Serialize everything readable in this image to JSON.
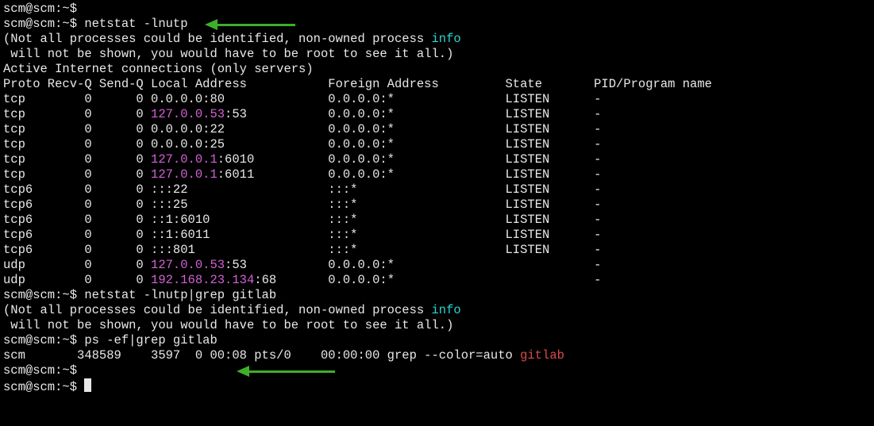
{
  "prompt_text": "scm@scm:~$",
  "cmd_netstat": " netstat -lnutp",
  "msg_line1a": "(Not all processes could be identified, non-owned process ",
  "msg_info": "info",
  "msg_line2": " will not be shown, you would have to be root to see it all.)",
  "active_conn": "Active Internet connections (only servers)",
  "hdr_proto": "Proto",
  "hdr_recvq": "Recv-Q",
  "hdr_sendq": "Send-Q",
  "hdr_local": "Local Address",
  "hdr_foreign": "Foreign Address",
  "hdr_state": "State",
  "hdr_pid": "PID/Program name",
  "rows": [
    {
      "proto": "tcp",
      "recvq": "0",
      "sendq": "0",
      "local_pre": "0.0.0.0:80",
      "local_ip": "",
      "local_post": "",
      "foreign": "0.0.0.0:*",
      "state": "LISTEN",
      "pid": "-"
    },
    {
      "proto": "tcp",
      "recvq": "0",
      "sendq": "0",
      "local_pre": "",
      "local_ip": "127.0.0.53",
      "local_post": ":53",
      "foreign": "0.0.0.0:*",
      "state": "LISTEN",
      "pid": "-"
    },
    {
      "proto": "tcp",
      "recvq": "0",
      "sendq": "0",
      "local_pre": "0.0.0.0:22",
      "local_ip": "",
      "local_post": "",
      "foreign": "0.0.0.0:*",
      "state": "LISTEN",
      "pid": "-"
    },
    {
      "proto": "tcp",
      "recvq": "0",
      "sendq": "0",
      "local_pre": "0.0.0.0:25",
      "local_ip": "",
      "local_post": "",
      "foreign": "0.0.0.0:*",
      "state": "LISTEN",
      "pid": "-"
    },
    {
      "proto": "tcp",
      "recvq": "0",
      "sendq": "0",
      "local_pre": "",
      "local_ip": "127.0.0.1",
      "local_post": ":6010",
      "foreign": "0.0.0.0:*",
      "state": "LISTEN",
      "pid": "-"
    },
    {
      "proto": "tcp",
      "recvq": "0",
      "sendq": "0",
      "local_pre": "",
      "local_ip": "127.0.0.1",
      "local_post": ":6011",
      "foreign": "0.0.0.0:*",
      "state": "LISTEN",
      "pid": "-"
    },
    {
      "proto": "tcp6",
      "recvq": "0",
      "sendq": "0",
      "local_pre": ":::22",
      "local_ip": "",
      "local_post": "",
      "foreign": ":::*",
      "state": "LISTEN",
      "pid": "-"
    },
    {
      "proto": "tcp6",
      "recvq": "0",
      "sendq": "0",
      "local_pre": ":::25",
      "local_ip": "",
      "local_post": "",
      "foreign": ":::*",
      "state": "LISTEN",
      "pid": "-"
    },
    {
      "proto": "tcp6",
      "recvq": "0",
      "sendq": "0",
      "local_pre": "::1:6010",
      "local_ip": "",
      "local_post": "",
      "foreign": ":::*",
      "state": "LISTEN",
      "pid": "-"
    },
    {
      "proto": "tcp6",
      "recvq": "0",
      "sendq": "0",
      "local_pre": "::1:6011",
      "local_ip": "",
      "local_post": "",
      "foreign": ":::*",
      "state": "LISTEN",
      "pid": "-"
    },
    {
      "proto": "tcp6",
      "recvq": "0",
      "sendq": "0",
      "local_pre": ":::801",
      "local_ip": "",
      "local_post": "",
      "foreign": ":::*",
      "state": "LISTEN",
      "pid": "-"
    },
    {
      "proto": "udp",
      "recvq": "0",
      "sendq": "0",
      "local_pre": "",
      "local_ip": "127.0.0.53",
      "local_post": ":53",
      "foreign": "0.0.0.0:*",
      "state": "",
      "pid": "-"
    },
    {
      "proto": "udp",
      "recvq": "0",
      "sendq": "0",
      "local_pre": "",
      "local_ip": "192.168.23.134",
      "local_post": ":68",
      "foreign": "0.0.0.0:*",
      "state": "",
      "pid": "-"
    }
  ],
  "cmd_netstat_grep": " netstat -lnutp|grep gitlab",
  "cmd_ps_grep": " ps -ef|grep gitlab",
  "ps_line_pre": "scm       348589    3597  0 00:08 pts/0    00:00:00 grep --color=auto ",
  "ps_gitlab": "gitlab",
  "local_col_width": 24,
  "foreign_col_width": 24,
  "state_col_width": 12
}
